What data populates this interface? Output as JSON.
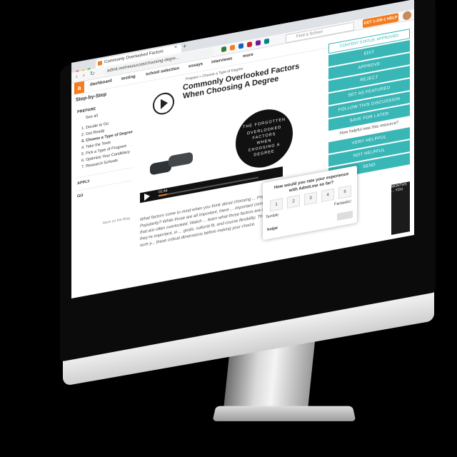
{
  "browser": {
    "tab_title": "Commonly Overlooked Factors",
    "tab_close": "×",
    "new_tab": "+",
    "url": "admit.me/resources/choosing-degre...",
    "search_placeholder": "Find a School",
    "help_button": "GET 1-ON-1 HELP"
  },
  "site_nav": {
    "logo": "a",
    "items": [
      "dashboard",
      "testing",
      "school selection",
      "essays",
      "interviews",
      "more"
    ]
  },
  "sidebar": {
    "heading": "Step-by-Step",
    "prepare": "PREPARE",
    "see_all": "See all",
    "steps": [
      "1.  Decide to Go",
      "2.  Get Ready",
      "3.  Choose a Type of Degree",
      "4.  Take the Tests",
      "5.  Pick a Type of Program",
      "6.  Optimize Your Candidacy",
      "7.  Research Schools"
    ],
    "apply": "APPLY",
    "go": "GO",
    "more_blog": "More on the Blog"
  },
  "article": {
    "breadcrumb": "Prepare » Choose a Type of Degree",
    "title": "Commonly Overlooked Factors When Choosing A Degree",
    "video_text": [
      "THE FORGOTTEN",
      "OVERLOOKED",
      "FACTORS",
      "WHEN",
      "CHOOSING A",
      "DEGREE"
    ],
    "video_time": "01:44",
    "body": "What factors come to mind when you think about choosing ... Prestige? Popularity? While those are all important, there ... important considerations that are often overlooked. Watch ... learn what those factors are and why they're important, in ... goals, cultural fit, and course flexibility. Then, make sure y... these critical dimensions before making your choice."
  },
  "right_panel": {
    "status": "CONTENT STATUS: APPROVED",
    "buttons": [
      "EDIT",
      "APPROVE",
      "REJECT",
      "SET AS FEATURED",
      "FOLLOW THIS DISCUSSION",
      "SAVE FOR LATER"
    ],
    "question": "How helpful was this resource?",
    "feedback": [
      "VERY HELPFUL",
      "NOT HELPFUL",
      "SEND"
    ],
    "thumb_text": "MONTHS ... YOU"
  },
  "survey": {
    "question": "How would you rate your experience with Admit.me so far?",
    "ratings": [
      "1",
      "2",
      "3",
      "4",
      "5"
    ],
    "low_label": "Terrible",
    "high_label": "Fantastic!",
    "brand": "hotjar"
  },
  "colors": {
    "accent_orange": "#f57c1f",
    "teal": "#39b6b6"
  }
}
